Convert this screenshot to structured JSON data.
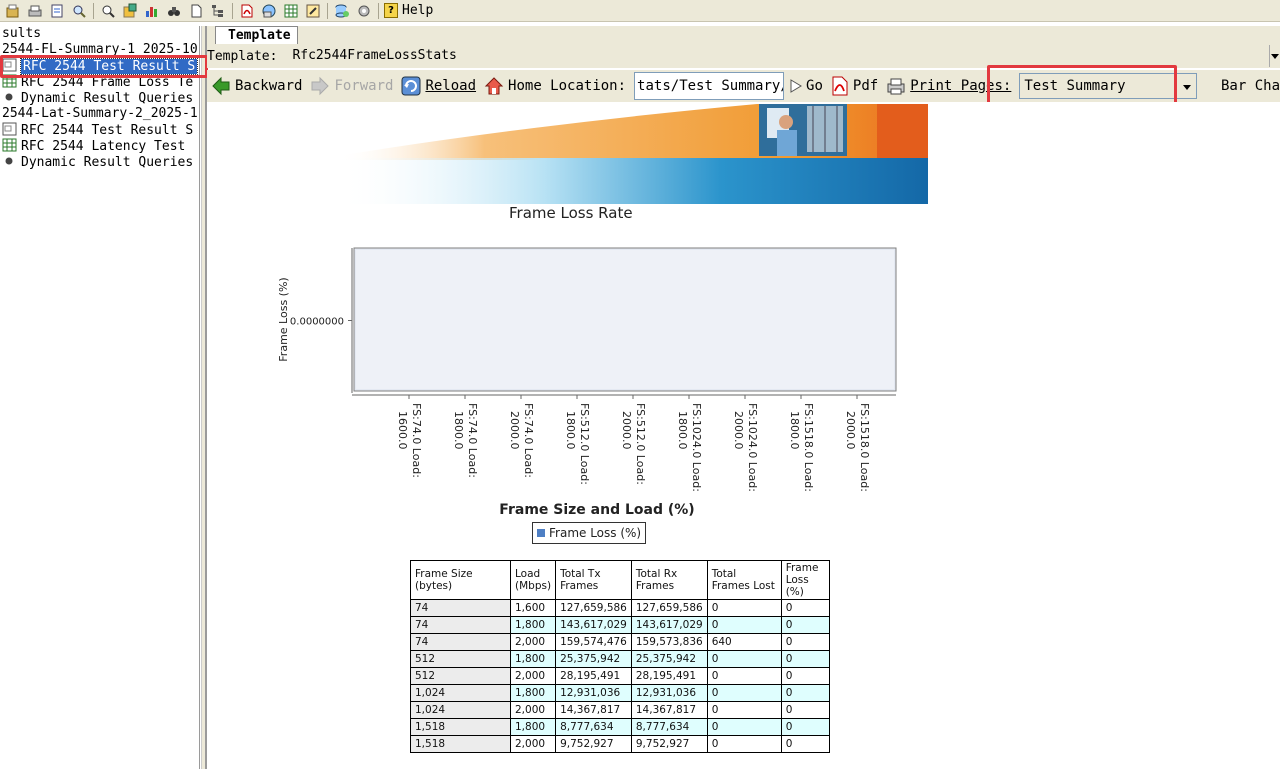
{
  "toolbar": {
    "icons": [
      "open-icon",
      "print-icon",
      "properties-icon",
      "find-icon",
      "zoom-icon",
      "export-icon",
      "chart-icon",
      "binoculars-icon",
      "page-icon",
      "tree-icon",
      "pdf-icon",
      "network-icon",
      "table-icon",
      "wizard-icon",
      "database-icon",
      "tools-icon"
    ],
    "help_label": "Help"
  },
  "tree": {
    "items": [
      {
        "label": "sults",
        "icon": "none",
        "selected": false
      },
      {
        "label": "2544-FL-Summary-1_2025-10",
        "icon": "none",
        "selected": false
      },
      {
        "label": "RFC 2544 Test Result S",
        "icon": "report-icon",
        "selected": true
      },
      {
        "label": "RFC 2544 Frame Loss Te",
        "icon": "table-icon",
        "selected": false
      },
      {
        "label": "Dynamic Result Queries",
        "icon": "bullet",
        "selected": false
      },
      {
        "label": "2544-Lat-Summary-2_2025-1",
        "icon": "none",
        "selected": false
      },
      {
        "label": "RFC 2544 Test Result S",
        "icon": "report-icon",
        "selected": false
      },
      {
        "label": "RFC 2544 Latency Test ",
        "icon": "table-icon",
        "selected": false
      },
      {
        "label": "Dynamic Result Queries",
        "icon": "bullet",
        "selected": false
      }
    ]
  },
  "tabs": {
    "template": "Template"
  },
  "template_row": {
    "label": "Template:",
    "value": "Rfc2544FrameLossStats"
  },
  "nav": {
    "backward": "Backward",
    "forward": "Forward",
    "reload": "Reload",
    "home_location": "Home Location:",
    "location_value": "tats/Test Summary/",
    "go": "Go",
    "pdf": "Pdf",
    "print_pages": "Print Pages:",
    "pages_value": "Test Summary",
    "bar_chart": "Bar Chart"
  },
  "report": {
    "title": "Frame Loss Rate"
  },
  "chart_data": {
    "type": "bar",
    "title": "Frame Loss Rate",
    "xlabel": "Frame Size and Load (%)",
    "ylabel": "Frame Loss (%)",
    "y_tick_labels": [
      "0.0000000"
    ],
    "categories": [
      [
        "FS:74.0 Load:",
        "1600.0"
      ],
      [
        "FS:74.0 Load:",
        "1800.0"
      ],
      [
        "FS:74.0 Load:",
        "2000.0"
      ],
      [
        "FS:512.0 Load:",
        "1800.0"
      ],
      [
        "FS:512.0 Load:",
        "2000.0"
      ],
      [
        "FS:1024.0 Load:",
        "1800.0"
      ],
      [
        "FS:1024.0 Load:",
        "2000.0"
      ],
      [
        "FS:1518.0 Load:",
        "1800.0"
      ],
      [
        "FS:1518.0 Load:",
        "2000.0"
      ]
    ],
    "series": [
      {
        "name": "Frame Loss (%)",
        "values": [
          0,
          0,
          0,
          0,
          0,
          0,
          0,
          0,
          0
        ],
        "color": "#4e7fc4"
      }
    ],
    "legend": "bottom"
  },
  "table": {
    "headers": [
      "Frame Size (bytes)",
      "Load (Mbps)",
      "Total Tx Frames",
      "Total Rx Frames",
      "Total Frames Lost",
      "Frame Loss (%)"
    ],
    "rows": [
      [
        "74",
        "1,600",
        "127,659,586",
        "127,659,586",
        "0",
        "0"
      ],
      [
        "74",
        "1,800",
        "143,617,029",
        "143,617,029",
        "0",
        "0"
      ],
      [
        "74",
        "2,000",
        "159,574,476",
        "159,573,836",
        "640",
        "0"
      ],
      [
        "512",
        "1,800",
        "25,375,942",
        "25,375,942",
        "0",
        "0"
      ],
      [
        "512",
        "2,000",
        "28,195,491",
        "28,195,491",
        "0",
        "0"
      ],
      [
        "1,024",
        "1,800",
        "12,931,036",
        "12,931,036",
        "0",
        "0"
      ],
      [
        "1,024",
        "2,000",
        "14,367,817",
        "14,367,817",
        "0",
        "0"
      ],
      [
        "1,518",
        "1,800",
        "8,777,634",
        "8,777,634",
        "0",
        "0"
      ],
      [
        "1,518",
        "2,000",
        "9,752,927",
        "9,752,927",
        "0",
        "0"
      ]
    ]
  },
  "colors": {
    "highlight": "#e2393f",
    "selection": "#316ac5",
    "alt_row": "#dffefe"
  }
}
